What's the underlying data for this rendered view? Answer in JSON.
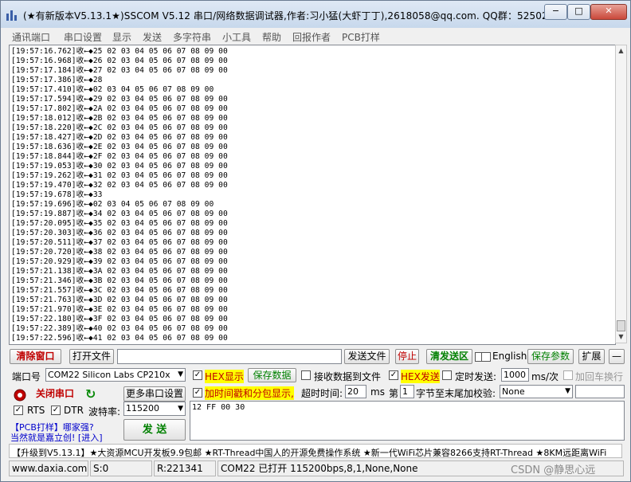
{
  "window": {
    "title": "(★有新版本V5.13.1★)SSCOM V5.12 串口/网络数据调试器,作者:习小猛(大虾丁丁),2618058@qq.com. QQ群：525024...",
    "minimize": "−",
    "maximize": "□",
    "close": "✕"
  },
  "menu": [
    "通讯端口",
    "串口设置",
    "显示",
    "发送",
    "多字符串",
    "小工具",
    "帮助",
    "回报作者",
    "PCB打样"
  ],
  "log": [
    "[19:57:16.762]收←◆25 02 03 04 05 06 07 08 09 00",
    "[19:57:16.968]收←◆26 02 03 04 05 06 07 08 09 00",
    "[19:57:17.184]收←◆27 02 03 04 05 06 07 08 09 00",
    "[19:57:17.386]收←◆28",
    "[19:57:17.410]收←◆02 03 04 05 06 07 08 09 00",
    "[19:57:17.594]收←◆29 02 03 04 05 06 07 08 09 00",
    "[19:57:17.802]收←◆2A 02 03 04 05 06 07 08 09 00",
    "[19:57:18.012]收←◆2B 02 03 04 05 06 07 08 09 00",
    "[19:57:18.220]收←◆2C 02 03 04 05 06 07 08 09 00",
    "[19:57:18.427]收←◆2D 02 03 04 05 06 07 08 09 00",
    "[19:57:18.636]收←◆2E 02 03 04 05 06 07 08 09 00",
    "[19:57:18.844]收←◆2F 02 03 04 05 06 07 08 09 00",
    "[19:57:19.053]收←◆30 02 03 04 05 06 07 08 09 00",
    "[19:57:19.262]收←◆31 02 03 04 05 06 07 08 09 00",
    "[19:57:19.470]收←◆32 02 03 04 05 06 07 08 09 00",
    "[19:57:19.678]收←◆33",
    "[19:57:19.696]收←◆02 03 04 05 06 07 08 09 00",
    "[19:57:19.887]收←◆34 02 03 04 05 06 07 08 09 00",
    "[19:57:20.095]收←◆35 02 03 04 05 06 07 08 09 00",
    "[19:57:20.303]收←◆36 02 03 04 05 06 07 08 09 00",
    "[19:57:20.511]收←◆37 02 03 04 05 06 07 08 09 00",
    "[19:57:20.720]收←◆38 02 03 04 05 06 07 08 09 00",
    "[19:57:20.929]收←◆39 02 03 04 05 06 07 08 09 00",
    "[19:57:21.138]收←◆3A 02 03 04 05 06 07 08 09 00",
    "[19:57:21.346]收←◆3B 02 03 04 05 06 07 08 09 00",
    "[19:57:21.557]收←◆3C 02 03 04 05 06 07 08 09 00",
    "[19:57:21.763]收←◆3D 02 03 04 05 06 07 08 09 00",
    "[19:57:21.970]收←◆3E 02 03 04 05 06 07 08 09 00",
    "[19:57:22.180]收←◆3F 02 03 04 05 06 07 08 09 00",
    "[19:57:22.389]收←◆40 02 03 04 05 06 07 08 09 00",
    "[19:57:22.596]收←◆41 02 03 04 05 06 07 08 09 00"
  ],
  "toolbar": {
    "clear_window": "清除窗口",
    "open_file": "打开文件",
    "file_path": "",
    "send_file": "发送文件",
    "stop": "停止",
    "clear_send": "清发送区",
    "english": "English",
    "save_params": "保存参数",
    "expand": "扩展",
    "collapse": "—"
  },
  "port": {
    "port_label": "端口号",
    "port_value": "COM22 Silicon Labs CP210x",
    "close_port": "关闭串口",
    "more_settings": "更多串口设置",
    "rts": "RTS",
    "dtr": "DTR",
    "baud_label": "波特率:",
    "baud_value": "115200"
  },
  "options": {
    "hex_display": "HEX显示",
    "save_data": "保存数据",
    "recv_to_file": "接收数据到文件",
    "timestamp": "加时间戳和分包显示,",
    "timeout_label": "超时时间:",
    "timeout_value": "20",
    "timeout_unit": "ms",
    "hex_send": "HEX发送",
    "timed_send": "定时发送:",
    "interval_value": "1000",
    "interval_unit": "ms/次",
    "add_crlf": "加回车换行",
    "byte_prefix": "第",
    "byte_value": "1",
    "byte_suffix": "字节至末尾加校验:",
    "checksum_value": "None"
  },
  "send": {
    "content": "12 FF 00 30",
    "button": "发 送"
  },
  "promo": {
    "line1": "【PCB打样】哪家强?",
    "line2": "当然就是嘉立创! [进入]"
  },
  "ticker": "【升级到V5.13.1】★大资源MCU开发板9.9包邮 ★RT-Thread中国人的开源免费操作系统 ★新一代WiFi芯片兼容8266支持RT-Thread ★8KM远距离WiFi",
  "status": {
    "website": "www.daxia.com",
    "sent": "S:0",
    "received": "R:221341",
    "port_status": "COM22 已打开  115200bps,8,1,None,None",
    "watermark": "CSDN @静思心远"
  },
  "colors": {
    "red_text": "#c00000",
    "green_text": "#008000",
    "highlight_yellow": "#ffff00",
    "blue_text": "#0000cc"
  }
}
